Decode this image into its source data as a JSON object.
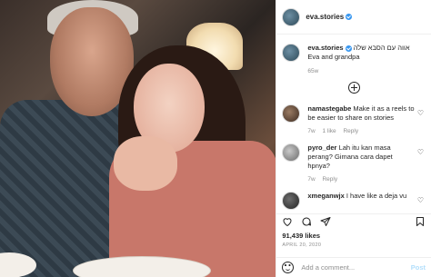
{
  "post": {
    "username": "eva.stories",
    "caption_line1": "אווה עם הסבא שלה",
    "caption_line2": "Eva and grandpa",
    "caption_time": "65w"
  },
  "comments": [
    {
      "user": "namastegabe",
      "text": "Make it as a reels to be easier to share on stories",
      "age": "7w",
      "likes": "1 like",
      "reply": "Reply"
    },
    {
      "user": "pyro_der",
      "text": "Lah itu kan masa perang? Gimana cara dapet hpnya?",
      "age": "7w",
      "likes": "",
      "reply": "Reply"
    },
    {
      "user": "xmeganwjx",
      "text": "I have like a deja vu",
      "age": "",
      "likes": "",
      "reply": ""
    }
  ],
  "stats": {
    "likes": "91,439 likes",
    "date": "APRIL 20, 2020"
  },
  "add_comment": {
    "placeholder": "Add a comment...",
    "post_label": "Post"
  },
  "icons": {
    "heart": "heart-icon",
    "comment": "comment-icon",
    "share": "share-icon",
    "bookmark": "bookmark-icon",
    "emoji": "emoji-icon",
    "load_more": "plus-circle-icon",
    "verified": "verified-badge-icon"
  },
  "colors": {
    "accent": "#3897f0",
    "muted": "#8e8e8e",
    "post_disabled": "#b2dffc"
  }
}
